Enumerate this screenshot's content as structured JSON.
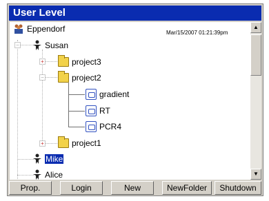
{
  "window": {
    "title": "User Level"
  },
  "tree": {
    "timestamp": "Mar/15/2007 01:21:39pm",
    "root": "Eppendorf",
    "users": [
      "Susan",
      "Mike",
      "Alice"
    ],
    "folders": [
      "project3",
      "project2",
      "project1"
    ],
    "files": [
      "gradient",
      "RT",
      "PCR4"
    ],
    "selected": "Mike"
  },
  "buttons": [
    "Prop.",
    "Login",
    "New",
    "NewFolder",
    "Shutdown"
  ]
}
